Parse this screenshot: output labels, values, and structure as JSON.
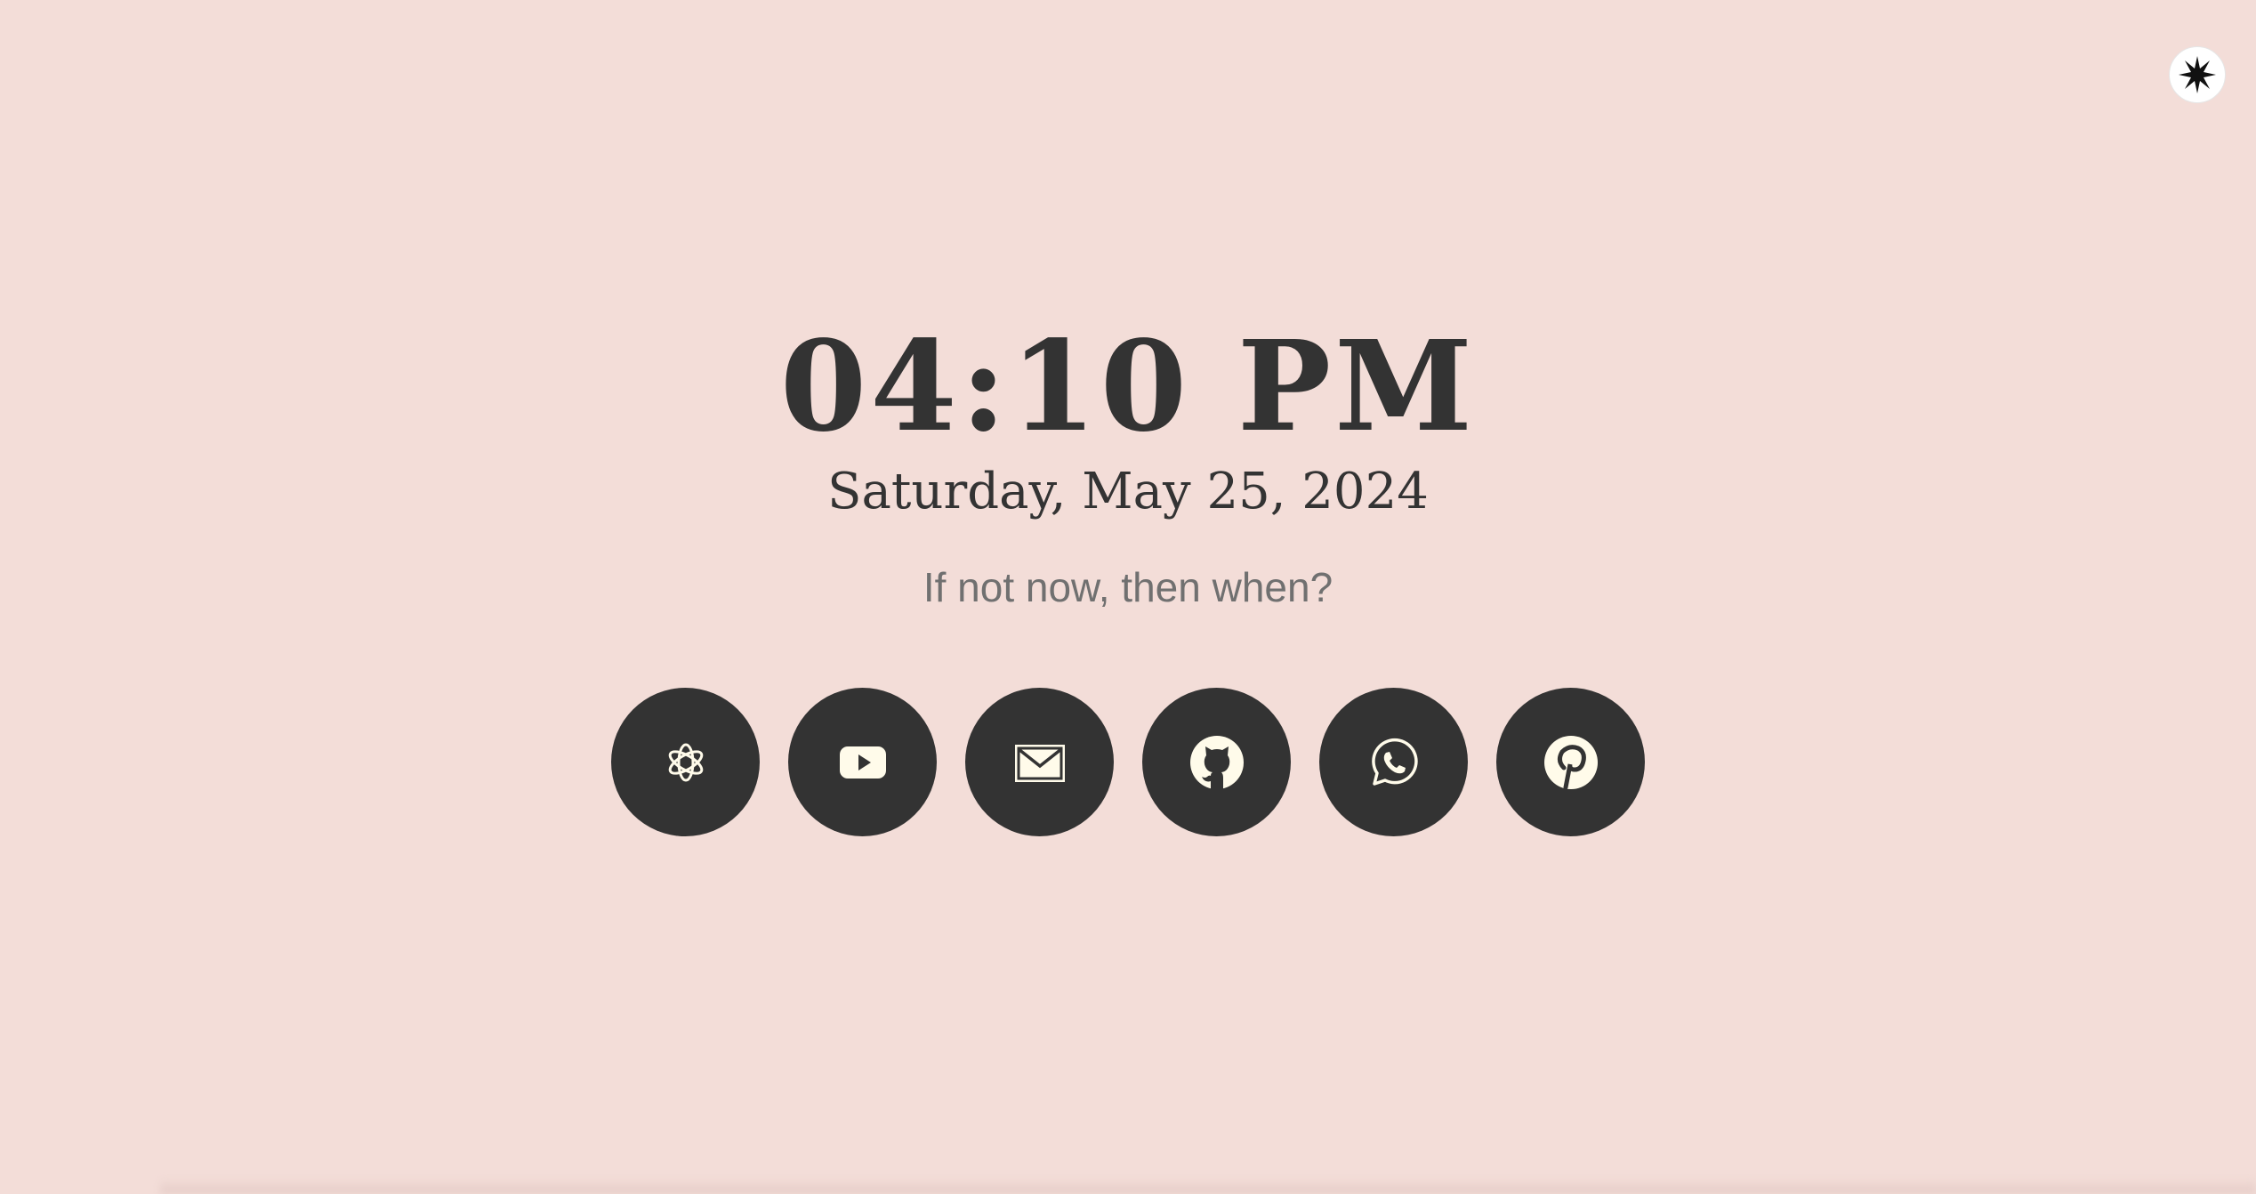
{
  "corner_button": {
    "icon": "asterisk-star-icon"
  },
  "clock": {
    "time": "04:10 PM",
    "date": "Saturday, May 25, 2024"
  },
  "quote": "If not now, then when?",
  "links": [
    {
      "name": "chatgpt",
      "icon": "openai-icon"
    },
    {
      "name": "youtube",
      "icon": "youtube-icon"
    },
    {
      "name": "gmail",
      "icon": "mail-icon"
    },
    {
      "name": "github",
      "icon": "github-icon"
    },
    {
      "name": "whatsapp",
      "icon": "whatsapp-icon"
    },
    {
      "name": "pinterest",
      "icon": "pinterest-icon"
    }
  ],
  "colors": {
    "background": "#f3ddd8",
    "text": "#333333",
    "quote": "#707070",
    "icon_fill": "#fffbea"
  }
}
